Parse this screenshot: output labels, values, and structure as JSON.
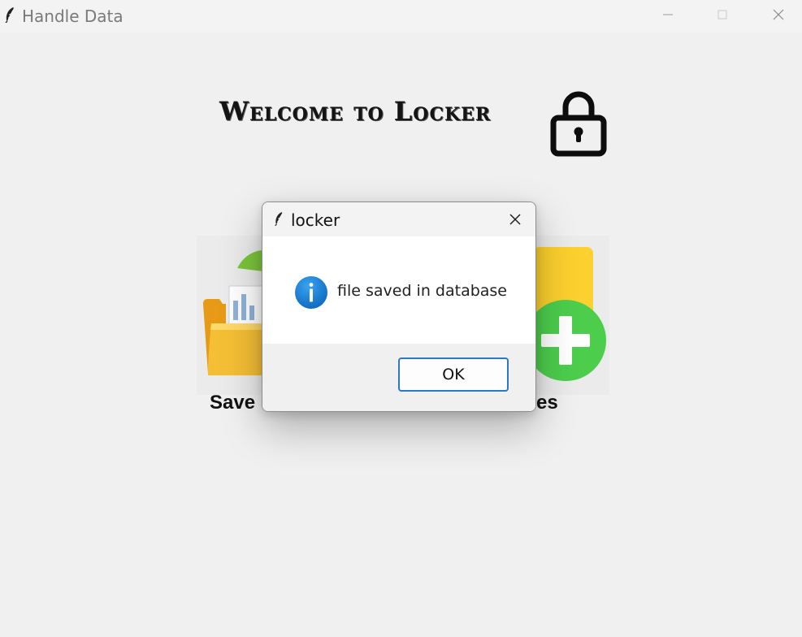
{
  "window": {
    "title": "Handle Data"
  },
  "main": {
    "heading": "Welcome to Locker",
    "tiles": [
      {
        "label": "Save",
        "icon": "folder-icon"
      },
      {
        "label": "es",
        "icon": "add-file-icon"
      }
    ]
  },
  "dialog": {
    "title": "locker",
    "message": "file saved in database",
    "ok_label": "OK",
    "icon": "info-icon"
  },
  "colors": {
    "accent": "#2f76c6",
    "info_blue": "#1a7fd4",
    "add_green": "#4cce4c",
    "folder_yellow": "#f4b62a"
  }
}
